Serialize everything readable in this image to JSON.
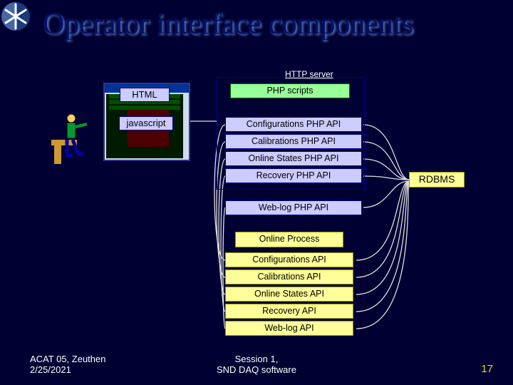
{
  "title": "Operator interface components",
  "http_server_label": "HTTP server",
  "browser": {
    "html_label": "HTML",
    "js_label": "javascript"
  },
  "php_block": {
    "header": "PHP scripts",
    "items": [
      "Configurations PHP API",
      "Calibrations PHP API",
      "Online States PHP API",
      "Recovery PHP API",
      "Web-log PHP API"
    ]
  },
  "process_block": {
    "header": "Online Process",
    "items": [
      "Configurations API",
      "Calibrations API",
      "Online States API",
      "Recovery API",
      "Web-log API"
    ]
  },
  "rdbms": "RDBMS",
  "footer": {
    "left_line1": "ACAT 05,  Zeuthen",
    "left_line2": "2/25/2021",
    "center_line1": "Session 1,",
    "center_line2": "SND DAQ software",
    "page": "17"
  }
}
